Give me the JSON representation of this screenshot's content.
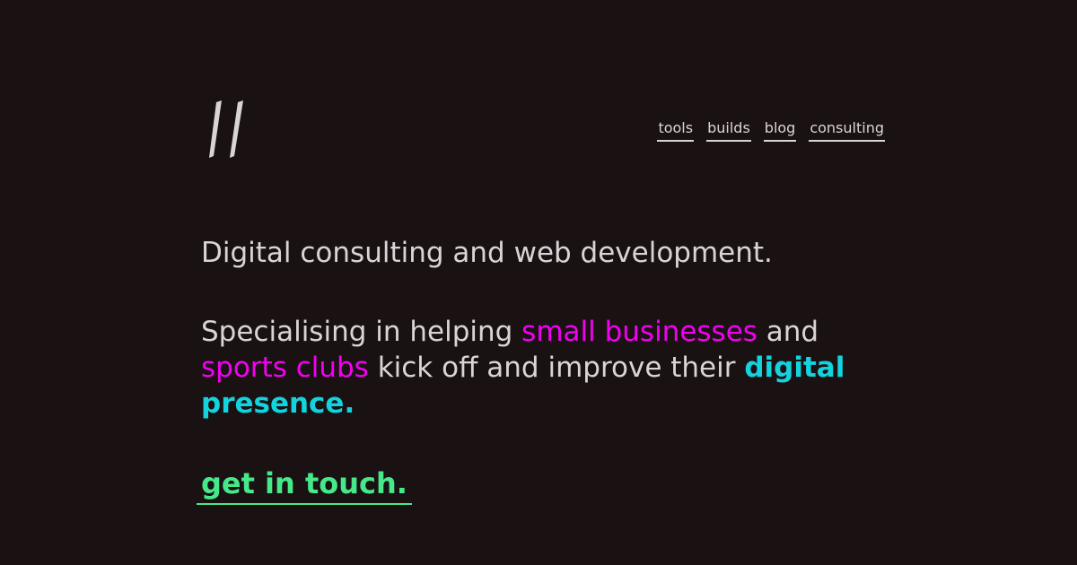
{
  "nav": {
    "items": [
      {
        "label": "tools"
      },
      {
        "label": "builds"
      },
      {
        "label": "blog"
      },
      {
        "label": "consulting"
      }
    ]
  },
  "hero": {
    "headline": "Digital consulting and web development.",
    "description": {
      "part1": "Specialising in helping ",
      "highlight1": "small businesses",
      "part2": " and ",
      "highlight2": "sports clubs",
      "part3": " kick off and improve their ",
      "highlight3": "digital presence."
    },
    "cta_label": "get in touch."
  },
  "colors": {
    "background": "#1a1113",
    "text": "#d9d5d6",
    "accent_pink": "#f200f2",
    "accent_cyan": "#12d3de",
    "accent_green": "#46e98a"
  },
  "icons": {
    "logo": "double-slash-logo-icon"
  }
}
